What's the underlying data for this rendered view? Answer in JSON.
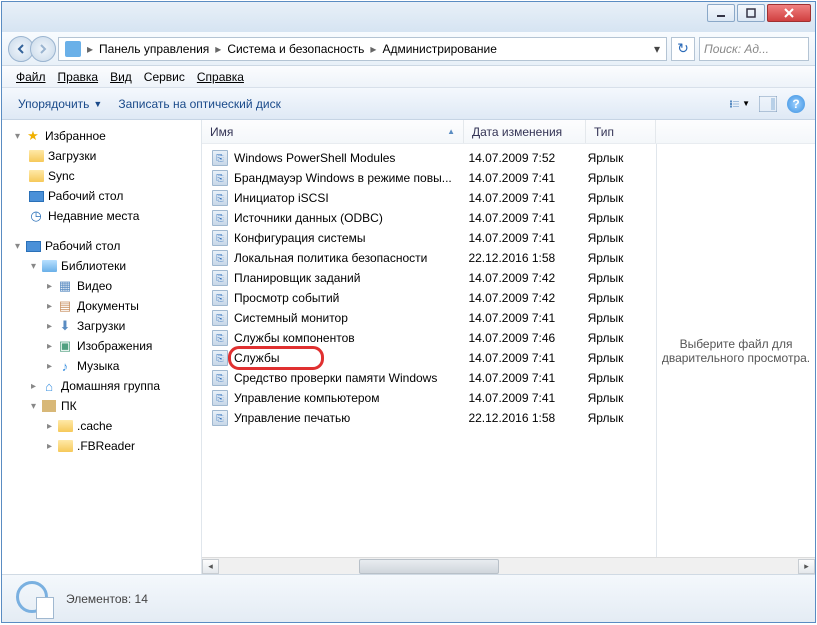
{
  "titlebar": {},
  "breadcrumb": {
    "items": [
      "Панель управления",
      "Система и безопасность",
      "Администрирование"
    ]
  },
  "search": {
    "placeholder": "Поиск: Ад..."
  },
  "menubar": {
    "file": "Файл",
    "edit": "Правка",
    "view": "Вид",
    "tools": "Сервис",
    "help": "Справка"
  },
  "toolbar": {
    "organize": "Упорядочить",
    "burn": "Записать на оптический диск"
  },
  "tree": {
    "favorites": "Избранное",
    "downloads": "Загрузки",
    "sync": "Sync",
    "desktop_fav": "Рабочий стол",
    "recent": "Недавние места",
    "desktop": "Рабочий стол",
    "libraries": "Библиотеки",
    "videos": "Видео",
    "documents": "Документы",
    "downloads2": "Загрузки",
    "images": "Изображения",
    "music": "Музыка",
    "homegroup": "Домашняя группа",
    "pc": "ПК",
    "cache": ".cache",
    "fbreader": ".FBReader"
  },
  "columns": {
    "name": "Имя",
    "date": "Дата изменения",
    "type": "Тип"
  },
  "files": [
    {
      "name": "Windows PowerShell Modules",
      "date": "14.07.2009 7:52",
      "type": "Ярлык"
    },
    {
      "name": "Брандмауэр Windows в режиме повы...",
      "date": "14.07.2009 7:41",
      "type": "Ярлык"
    },
    {
      "name": "Инициатор iSCSI",
      "date": "14.07.2009 7:41",
      "type": "Ярлык"
    },
    {
      "name": "Источники данных (ODBC)",
      "date": "14.07.2009 7:41",
      "type": "Ярлык"
    },
    {
      "name": "Конфигурация системы",
      "date": "14.07.2009 7:41",
      "type": "Ярлык"
    },
    {
      "name": "Локальная политика безопасности",
      "date": "22.12.2016 1:58",
      "type": "Ярлык"
    },
    {
      "name": "Планировщик заданий",
      "date": "14.07.2009 7:42",
      "type": "Ярлык"
    },
    {
      "name": "Просмотр событий",
      "date": "14.07.2009 7:42",
      "type": "Ярлык"
    },
    {
      "name": "Системный монитор",
      "date": "14.07.2009 7:41",
      "type": "Ярлык"
    },
    {
      "name": "Службы компонентов",
      "date": "14.07.2009 7:46",
      "type": "Ярлык"
    },
    {
      "name": "Службы",
      "date": "14.07.2009 7:41",
      "type": "Ярлык",
      "hl": true
    },
    {
      "name": "Средство проверки памяти Windows",
      "date": "14.07.2009 7:41",
      "type": "Ярлык"
    },
    {
      "name": "Управление компьютером",
      "date": "14.07.2009 7:41",
      "type": "Ярлык"
    },
    {
      "name": "Управление печатью",
      "date": "22.12.2016 1:58",
      "type": "Ярлык"
    }
  ],
  "preview": {
    "text": "Выберите файл для дварительного просмотра."
  },
  "status": {
    "text": "Элементов: 14"
  }
}
